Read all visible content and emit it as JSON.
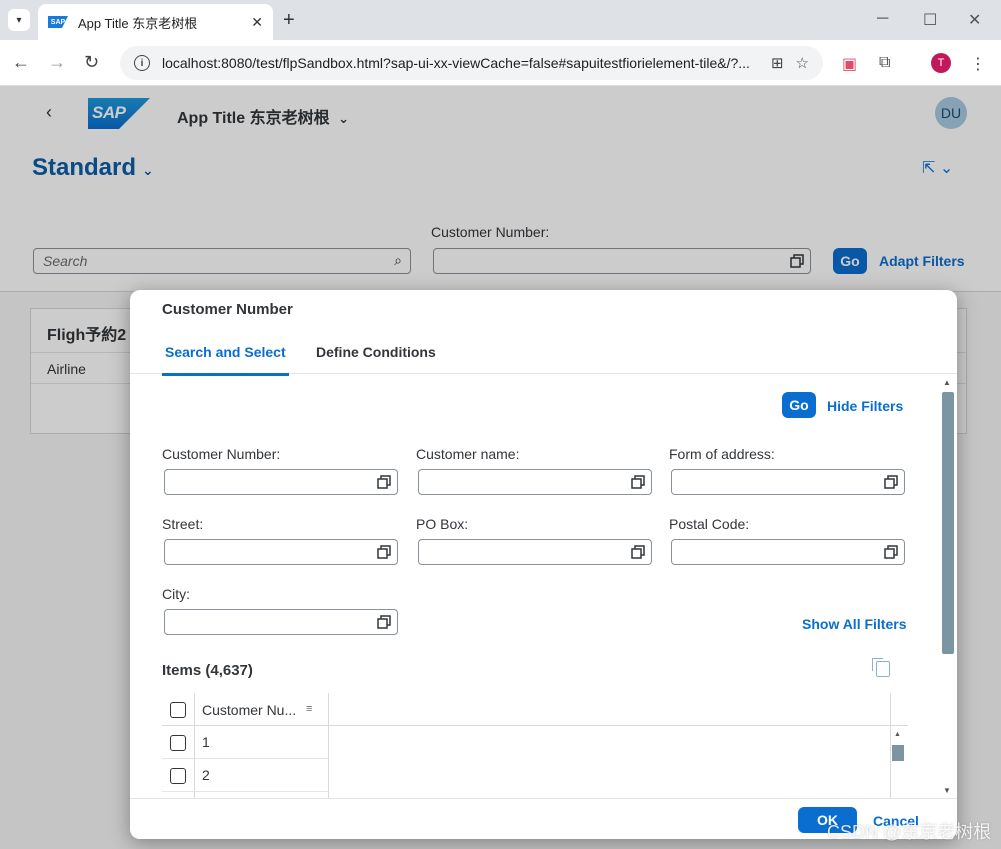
{
  "browser": {
    "tab_title": "App Title 东京老树根",
    "tab_close": "✕",
    "new_tab": "+",
    "url": "localhost:8080/test/flpSandbox.html?sap-ui-xx-viewCache=false#sapuitestfiorielement-tile&/?...",
    "profile_initial": "T",
    "icons": [
      "tab-menu-icon",
      "translate-icon",
      "star-icon",
      "extension-icon",
      "puzzle-icon",
      "menu-icon"
    ]
  },
  "shell": {
    "logo": "SAP",
    "app_title": "App Title 东京老树根",
    "app_title_chevron": "⌄",
    "avatar": "DU"
  },
  "header": {
    "variant": "Standard",
    "search_placeholder": "Search",
    "filter_label": "Customer Number:",
    "go": "Go",
    "adapt_filters": "Adapt Filters"
  },
  "table": {
    "title": "Fligh予約2",
    "column": "Airline"
  },
  "dialog": {
    "title": "Customer Number",
    "tabs": [
      "Search and Select",
      "Define Conditions"
    ],
    "go": "Go",
    "hide_filters": "Hide Filters",
    "show_all_filters": "Show All Filters",
    "filters": [
      {
        "label": "Customer Number:"
      },
      {
        "label": "Customer name:"
      },
      {
        "label": "Form of address:"
      },
      {
        "label": "Street:"
      },
      {
        "label": "PO Box:"
      },
      {
        "label": "Postal Code:"
      },
      {
        "label": "City:"
      }
    ],
    "items_title": "Items (4,637)",
    "grid_column": "Customer Nu...",
    "rows": [
      "1",
      "2"
    ],
    "ok": "OK",
    "cancel": "Cancel"
  },
  "watermark": "CSDN @东京老树根",
  "colors": {
    "accent": "#0a6ed1",
    "variant_text": "#0a5ea8",
    "scroll_thumb": "#7b95a3"
  }
}
